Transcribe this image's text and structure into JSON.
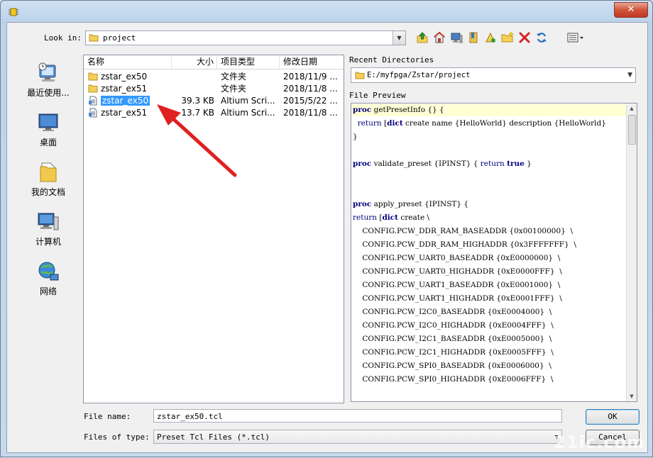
{
  "window": {
    "close_symbol": "✕"
  },
  "look_in": {
    "label": "Look in:",
    "value": "project"
  },
  "toolbar": {
    "icons": [
      "up-folder-icon",
      "home-icon",
      "computer-icon",
      "bookmark-icon",
      "bookmark-add-icon",
      "new-folder-icon",
      "delete-icon",
      "refresh-icon",
      "view-menu-icon"
    ]
  },
  "places": [
    {
      "label": "最近使用..."
    },
    {
      "label": "桌面"
    },
    {
      "label": "我的文档"
    },
    {
      "label": "计算机"
    },
    {
      "label": "网络"
    }
  ],
  "file_list": {
    "columns": [
      "名称",
      "大小",
      "项目类型",
      "修改日期"
    ],
    "rows": [
      {
        "name": "zstar_ex50",
        "size": "",
        "type": "文件夹",
        "date": "2018/11/9 ...",
        "kind": "folder",
        "selected": false
      },
      {
        "name": "zstar_ex51",
        "size": "",
        "type": "文件夹",
        "date": "2018/11/8 ...",
        "kind": "folder",
        "selected": false
      },
      {
        "name": "zstar_ex50",
        "size": "39.3 KB",
        "type": "Altium Scri...",
        "date": "2015/5/22 ...",
        "kind": "script",
        "selected": true
      },
      {
        "name": "zstar_ex51",
        "size": "13.7 KB",
        "type": "Altium Scri...",
        "date": "2018/11/8 ...",
        "kind": "script",
        "selected": false
      }
    ]
  },
  "recent": {
    "label": "Recent Directories",
    "value": "E:/myfpga/Zstar/project"
  },
  "preview": {
    "label": "File Preview",
    "lines": [
      [
        [
          "kw",
          "proc"
        ],
        [
          "t",
          " getPresetInfo {} {"
        ]
      ],
      [
        [
          "t",
          "  "
        ],
        [
          "ret",
          "return"
        ],
        [
          "t",
          " ["
        ],
        [
          "kw",
          "dict"
        ],
        [
          "t",
          " create name {HelloWorld} description {HelloWorld}"
        ]
      ],
      [
        [
          "t",
          "}"
        ]
      ],
      [
        [
          "t",
          ""
        ]
      ],
      [
        [
          "kw",
          "proc"
        ],
        [
          "t",
          " validate_preset {IPINST} { "
        ],
        [
          "ret",
          "return"
        ],
        [
          "t",
          " "
        ],
        [
          "kw",
          "true"
        ],
        [
          "t",
          " }"
        ]
      ],
      [
        [
          "t",
          ""
        ]
      ],
      [
        [
          "t",
          ""
        ]
      ],
      [
        [
          "kw",
          "proc"
        ],
        [
          "t",
          " apply_preset {IPINST} {"
        ]
      ],
      [
        [
          "ret",
          "return"
        ],
        [
          "t",
          " ["
        ],
        [
          "kw",
          "dict"
        ],
        [
          "t",
          " create \\"
        ]
      ],
      [
        [
          "t",
          "    CONFIG.PCW_DDR_RAM_BASEADDR {0x00100000}  \\"
        ]
      ],
      [
        [
          "t",
          "    CONFIG.PCW_DDR_RAM_HIGHADDR {0x3FFFFFFF}  \\"
        ]
      ],
      [
        [
          "t",
          "    CONFIG.PCW_UART0_BASEADDR {0xE0000000}  \\"
        ]
      ],
      [
        [
          "t",
          "    CONFIG.PCW_UART0_HIGHADDR {0xE0000FFF}  \\"
        ]
      ],
      [
        [
          "t",
          "    CONFIG.PCW_UART1_BASEADDR {0xE0001000}  \\"
        ]
      ],
      [
        [
          "t",
          "    CONFIG.PCW_UART1_HIGHADDR {0xE0001FFF}  \\"
        ]
      ],
      [
        [
          "t",
          "    CONFIG.PCW_I2C0_BASEADDR {0xE0004000}  \\"
        ]
      ],
      [
        [
          "t",
          "    CONFIG.PCW_I2C0_HIGHADDR {0xE0004FFF}  \\"
        ]
      ],
      [
        [
          "t",
          "    CONFIG.PCW_I2C1_BASEADDR {0xE0005000}  \\"
        ]
      ],
      [
        [
          "t",
          "    CONFIG.PCW_I2C1_HIGHADDR {0xE0005FFF}  \\"
        ]
      ],
      [
        [
          "t",
          "    CONFIG.PCW_SPI0_BASEADDR {0xE0006000}  \\"
        ]
      ],
      [
        [
          "t",
          "    CONFIG.PCW_SPI0_HIGHADDR {0xE0006FFF}  \\"
        ]
      ]
    ]
  },
  "file_name": {
    "label": "File name:",
    "value": "zstar_ex50.tcl"
  },
  "file_type": {
    "label": "Files of type:",
    "value": "Preset Tcl Files (*.tcl)"
  },
  "buttons": {
    "ok": "OK",
    "cancel": "Cancel"
  },
  "watermark": "21ic.com",
  "colors": {
    "selection": "#3399ff",
    "keyword": "#00007f",
    "arrow": "#e02020"
  }
}
